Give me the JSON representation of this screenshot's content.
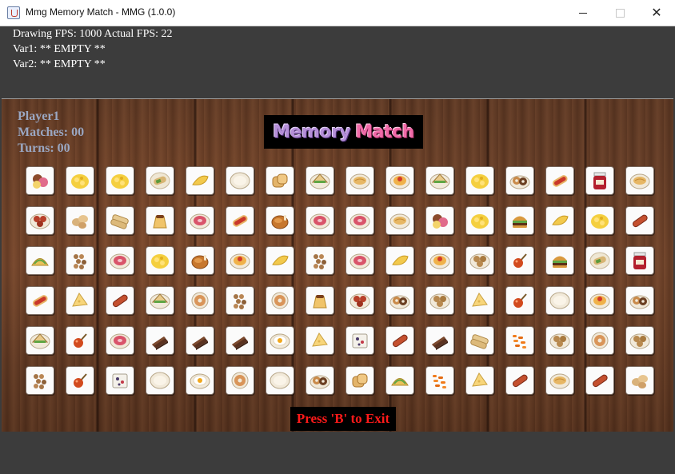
{
  "window": {
    "title": "Mmg Memory Match - MMG (1.0.0)"
  },
  "debug": {
    "fps": "Drawing FPS: 1000 Actual FPS: 22",
    "var1": "Var1: ** EMPTY **",
    "var2": "Var2: ** EMPTY **"
  },
  "hud": {
    "player": "Player1",
    "matches": "Matches: 00",
    "turns": "Turns: 00"
  },
  "logo": {
    "word1": "Memory",
    "word2": "Match"
  },
  "footer": {
    "exit_hint": "Press 'B' to Exit"
  },
  "grid": {
    "rows": [
      [
        "fruit-mix",
        "scrambled-egg",
        "scrambled-egg",
        "burrito",
        "pear-slice",
        "plate",
        "bread-loaf",
        "sandwich",
        "noodles",
        "pasta",
        "sandwich",
        "scrambled-egg",
        "donuts",
        "hotdog",
        "jam-jar",
        "noodles"
      ],
      [
        "meatballs",
        "potatoes",
        "spring-roll",
        "pudding",
        "ham",
        "hotdog",
        "roast-chicken",
        "ham",
        "ham",
        "noodles",
        "fruit-mix",
        "scrambled-egg",
        "burger",
        "pear-slice",
        "scrambled-egg",
        "sausage"
      ],
      [
        "taco",
        "nuts",
        "ham",
        "scrambled-egg",
        "roast-chicken",
        "pasta",
        "pear-slice",
        "nuts",
        "ham",
        "pear-slice",
        "pasta",
        "cookies",
        "cherry-lollipop",
        "burger",
        "burrito",
        "jam-jar"
      ],
      [
        "hotdog",
        "cheese-wedge",
        "sausage",
        "sandwich",
        "donut",
        "nuts",
        "donut",
        "pudding",
        "meatballs",
        "donuts",
        "cookies",
        "cheese-wedge",
        "cherry-lollipop",
        "plate",
        "pasta",
        "donuts"
      ],
      [
        "sandwich",
        "cherry-lollipop",
        "ham",
        "chocolate-cake",
        "chocolate-cake",
        "chocolate-cake",
        "fried-egg",
        "cheese-wedge",
        "rice-bowl",
        "sausage",
        "chocolate-cake",
        "spring-roll",
        "cheetos",
        "cookies",
        "donut",
        "cookies"
      ],
      [
        "nuts",
        "cherry-lollipop",
        "rice-bowl",
        "plate",
        "fried-egg",
        "donut",
        "plate",
        "donuts",
        "bread-loaf",
        "taco",
        "cheetos",
        "cheese-wedge",
        "sausage",
        "noodles",
        "sausage",
        "potatoes"
      ]
    ]
  }
}
